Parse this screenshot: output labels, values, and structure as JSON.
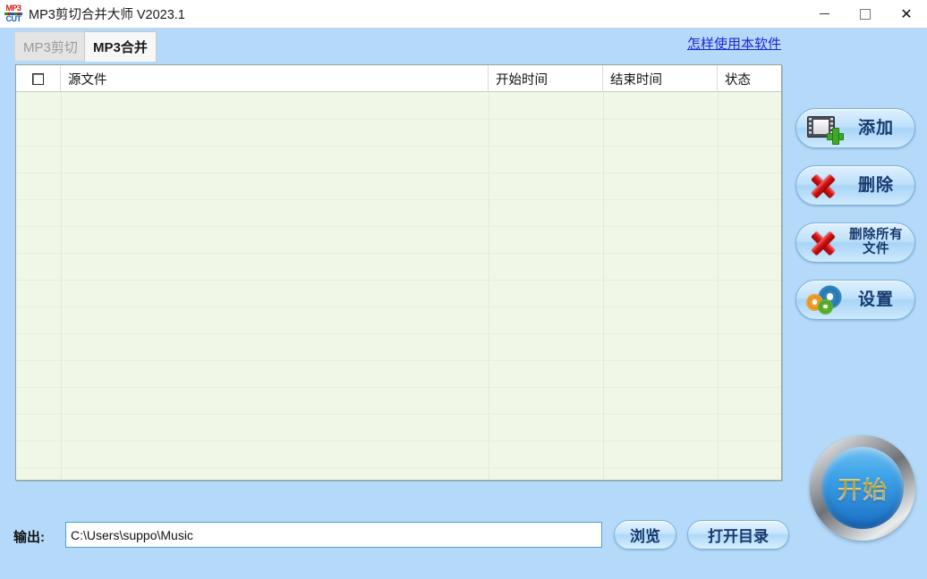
{
  "window": {
    "title": "MP3剪切合并大师 V2023.1",
    "app_icon": {
      "name": "mp3-cut-icon",
      "top_text": "MP3",
      "bottom_text": "CUT"
    },
    "controls": {
      "minimize": "—",
      "maximize": "",
      "close": "✕"
    }
  },
  "tabs": [
    {
      "id": "mp3-cut",
      "label": "MP3剪切",
      "active": false
    },
    {
      "id": "mp3-merge",
      "label": "MP3合并",
      "active": true
    }
  ],
  "help_link": {
    "label": "怎样使用本软件",
    "color": "#1c25d8"
  },
  "table": {
    "columns": [
      {
        "key": "check",
        "label": ""
      },
      {
        "key": "file",
        "label": "源文件"
      },
      {
        "key": "start",
        "label": "开始时间"
      },
      {
        "key": "end",
        "label": "结束时间"
      },
      {
        "key": "state",
        "label": "状态"
      }
    ],
    "rows": [],
    "row_count": 0,
    "body_color": "#f1f7e6",
    "header_color": "#ffffff"
  },
  "side_buttons": [
    {
      "id": "add",
      "icon": "film-add-icon",
      "label": "添加",
      "two_line": false
    },
    {
      "id": "delete",
      "icon": "red-x-icon",
      "label": "删除",
      "two_line": false
    },
    {
      "id": "delete-all",
      "icon": "red-x-icon",
      "label": "删除所有\n文件",
      "two_line": true
    },
    {
      "id": "settings",
      "icon": "gears-icon",
      "label": "设置",
      "two_line": false
    }
  ],
  "start_button": {
    "label": "开始",
    "name": "start-button"
  },
  "output": {
    "label": "输出:",
    "path": "C:\\Users\\suppo\\Music",
    "placeholder": "",
    "browse_label": "浏览",
    "open_dir_label": "打开目录"
  },
  "colors": {
    "background": "#b5daf9",
    "titlebar": "#ffffff",
    "accent_blue": "#16396e",
    "link": "#1c25d8",
    "table_body": "#f1f7e6"
  }
}
